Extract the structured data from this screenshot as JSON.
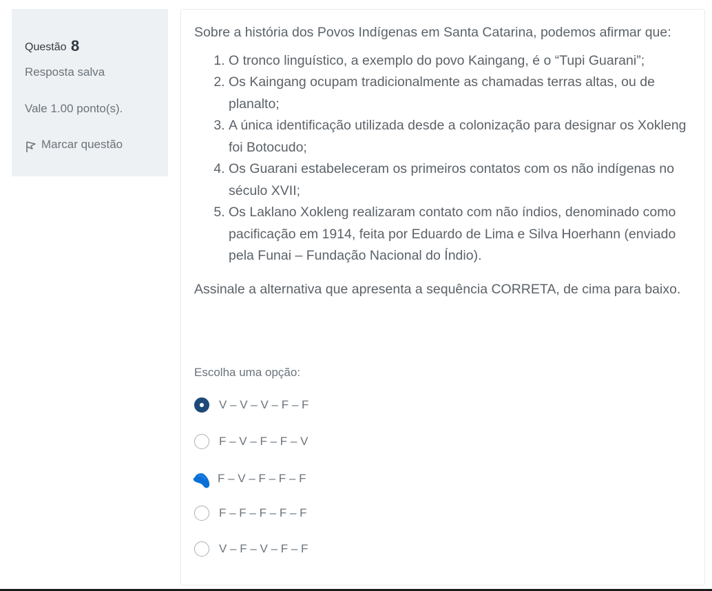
{
  "info": {
    "question_label": "Questão",
    "question_number": "8",
    "state": "Resposta salva",
    "grade": "Vale 1.00 ponto(s).",
    "flag_label": "Marcar questão",
    "flag_icon": "flag-icon"
  },
  "question": {
    "intro": "Sobre a história dos Povos Indígenas em Santa Catarina, podemos afirmar que:",
    "items": [
      "O tronco linguístico, a exemplo do povo Kaingang, é o “Tupi Guarani”;",
      "Os Kaingang ocupam tradicionalmente as chamadas terras altas, ou de planalto;",
      "A única identificação utilizada desde a colonização para designar os Xokleng foi Botocudo;",
      "Os Guarani estabeleceram os primeiros contatos com os não indígenas no século XVII;",
      "Os Laklano Xokleng realizaram contato com não índios, denominado como pacificação em 1914, feita por Eduardo de Lima e Silva Hoerhann (enviado pela Funai – Fundação Nacional do Índio)."
    ],
    "closing": "Assinale a alternativa que apresenta a sequência CORRETA, de cima para baixo."
  },
  "answer": {
    "prompt": "Escolha uma opção:",
    "options": [
      {
        "label": "V – V – V – F – F",
        "selected": true
      },
      {
        "label": "F – V – F – F – V",
        "selected": false
      },
      {
        "label": "F – V – F – F – F",
        "selected": false
      },
      {
        "label": "F – F – F – F – F",
        "selected": false
      },
      {
        "label": "V – F – V – F – F",
        "selected": false
      }
    ]
  },
  "colors": {
    "selected_radio": "#1d4a78",
    "scribble": "#0a6fd6",
    "panel_bg": "#eef1f3"
  }
}
